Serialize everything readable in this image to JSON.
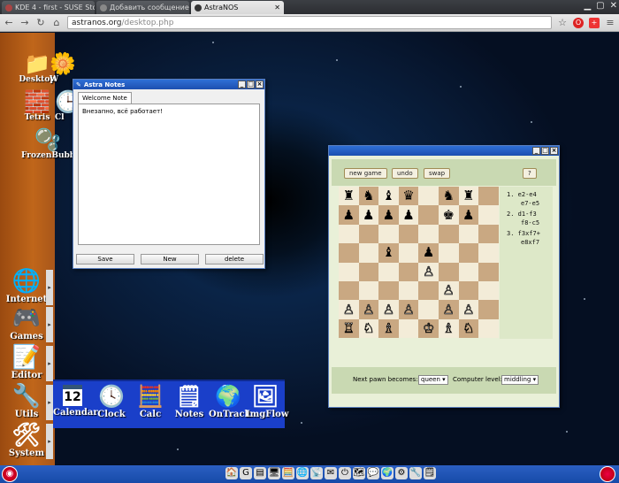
{
  "browser": {
    "tabs": [
      {
        "title": "KDE 4 - first - SUSE Sto"
      },
      {
        "title": "Добавить сообщение"
      },
      {
        "title": "AstraNOS",
        "active": true
      }
    ],
    "url_host": "astranos.org",
    "url_path": "/desktop.php"
  },
  "desktop_icons": [
    {
      "label": "Desktop",
      "icon": "folder-icon"
    },
    {
      "label": "W",
      "icon": "flower-icon"
    },
    {
      "label": "Tetris",
      "icon": "tetris-icon"
    },
    {
      "label": "Cl",
      "icon": "clock-icon"
    },
    {
      "label": "FrozenBubble",
      "icon": "frozenbubble-icon"
    }
  ],
  "side_menu": [
    {
      "label": "Internet",
      "icon": "globe-icon"
    },
    {
      "label": "Games",
      "icon": "gamepad-icon"
    },
    {
      "label": "Editor",
      "icon": "editor-icon"
    },
    {
      "label": "Utils",
      "icon": "drill-icon"
    },
    {
      "label": "System",
      "icon": "tools-icon"
    }
  ],
  "dock": [
    {
      "label": "Calendar",
      "icon": "calendar-icon",
      "day": "12"
    },
    {
      "label": "Clock",
      "icon": "clock-icon"
    },
    {
      "label": "Calc",
      "icon": "calculator-icon"
    },
    {
      "label": "Notes",
      "icon": "notes-icon"
    },
    {
      "label": "OnTrack",
      "icon": "ontrack-icon"
    },
    {
      "label": "ImgFlow",
      "icon": "imgflow-icon"
    }
  ],
  "notes_window": {
    "title": "Astra Notes",
    "tab": "Welcome Note",
    "text": "Внезапно, всё работает!",
    "buttons": {
      "save": "Save",
      "new": "New",
      "delete": "delete"
    }
  },
  "chess": {
    "buttons": {
      "new_game": "new game",
      "undo": "undo",
      "swap": "swap",
      "help": "?"
    },
    "board": [
      [
        "bR",
        "bN",
        "bB",
        "bQ",
        "",
        "bN",
        "bR",
        ""
      ],
      [
        "bP",
        "bP",
        "bP",
        "bP",
        "",
        "bK",
        "bP",
        ""
      ],
      [
        "",
        "",
        "",
        "",
        "",
        "",
        "",
        ""
      ],
      [
        "",
        "",
        "bB",
        "",
        "bP",
        "",
        "",
        ""
      ],
      [
        "",
        "",
        "",
        "",
        "wP",
        "",
        "",
        ""
      ],
      [
        "",
        "",
        "",
        "",
        "",
        "wP",
        "",
        ""
      ],
      [
        "wP",
        "wP",
        "wP",
        "wP",
        "",
        "wP",
        "wP",
        ""
      ],
      [
        "wR",
        "wN",
        "wB",
        "",
        "wK",
        "wB",
        "wN",
        ""
      ]
    ],
    "moves": [
      {
        "num": "1.",
        "white": "e2-e4",
        "black": "e7-e5"
      },
      {
        "num": "2.",
        "white": "d1-f3",
        "black": "f8-c5"
      },
      {
        "num": "3.",
        "white": "f3xf7+",
        "black": "e8xf7"
      }
    ],
    "pawn_label": "Next pawn becomes:",
    "pawn_value": "queen",
    "level_label": "Computer level:",
    "level_value": "middling"
  },
  "colors": {
    "panel": "#c0661a",
    "dock": "#1a3fc9",
    "taskbar": "#2b5fc2",
    "titlebar": "#1c4fb0"
  }
}
